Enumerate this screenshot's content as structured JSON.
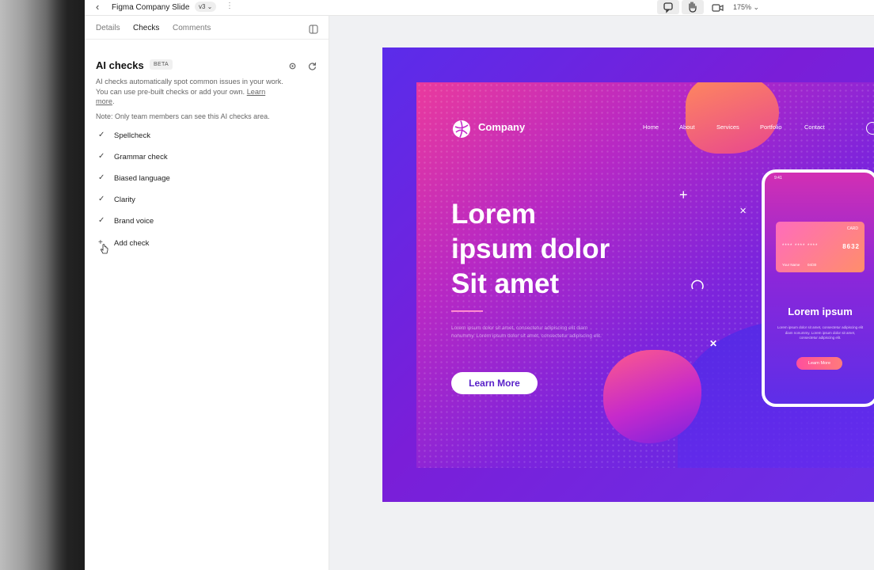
{
  "topbar": {
    "back_icon": "chevron-left-icon",
    "file_title": "Figma Company Slide",
    "version": "v3",
    "zoom": "175%"
  },
  "panel": {
    "tabs": [
      {
        "label": "Details"
      },
      {
        "label": "Checks"
      },
      {
        "label": "Comments"
      }
    ],
    "active_tab": "Checks",
    "title": "AI checks",
    "badge": "BETA",
    "description": "AI checks automatically spot common issues in your work. You can use pre-built checks or add your own.",
    "learn_more": "Learn more",
    "note": "Note: Only team members can see this AI checks area.",
    "checks": [
      {
        "label": "Spellcheck"
      },
      {
        "label": "Grammar check"
      },
      {
        "label": "Biased language"
      },
      {
        "label": "Clarity"
      },
      {
        "label": "Brand voice"
      }
    ],
    "add_check": "Add check"
  },
  "slide": {
    "brand": "Company",
    "nav": [
      "Home",
      "About",
      "Services",
      "Portfolio",
      "Contact"
    ],
    "headline_lines": [
      "Lorem",
      "ipsum dolor",
      "Sit amet"
    ],
    "body": "Lorem ipsum dolor sit amet, consectetur adipiscing elit diam nonummy. Lorem ipsum dolor sit amet, consectetur adipiscing elit.",
    "cta": "Learn More",
    "phone": {
      "time": "9:41",
      "card_type": "CARD",
      "card_number_stars": "**** **** ****",
      "card_number": "8632",
      "card_name_label": "Card Holder",
      "card_name": "Your Name",
      "card_date_label": "Expires",
      "card_date": "04/30",
      "title": "Lorem ipsum",
      "text": "Lorem ipsum dolor sit amet, consectetur adipiscing elit diam nonummy. Lorem ipsum dolor sit amet, consectetur adipiscing elit.",
      "button": "Learn More"
    }
  },
  "colors": {
    "slide_accent": "#7c24dc",
    "slide_pink": "#ea3a9d",
    "cta_text": "#5a22c9"
  }
}
